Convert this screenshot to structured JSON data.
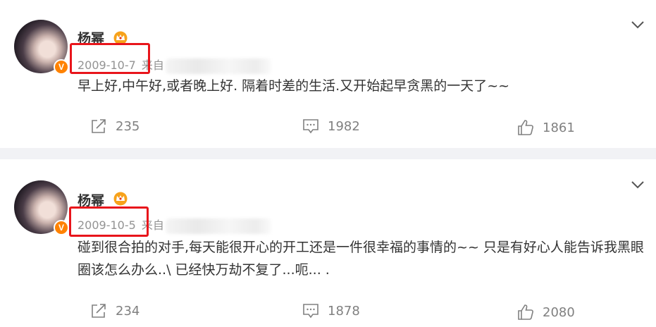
{
  "posts": [
    {
      "username": "杨幂",
      "date": "2009-10-7",
      "source_prefix": "来自",
      "text": "早上好,中午好,或者晚上好.  隔着时差的生活.又开始起早贪黑的一天了~~",
      "repost_count": "235",
      "comment_count": "1982",
      "like_count": "1861"
    },
    {
      "username": "杨幂",
      "date": "2009-10-5",
      "source_prefix": "来自",
      "text": "碰到很合拍的对手,每天能很开心的开工还是一件很幸福的事情的~~  只是有好心人能告诉我黑眼圈该怎么办么..\\  已经快万劫不复了...呃...  .",
      "repost_count": "234",
      "comment_count": "1878",
      "like_count": "2080"
    }
  ],
  "icons": {
    "verified": "verified-v-badge",
    "vip": "crown-icon",
    "repost": "repost-icon",
    "comment": "comment-icon",
    "like": "like-icon",
    "menu": "chevron-down-icon"
  },
  "colors": {
    "highlight_box": "#e8151b",
    "verified_badge": "#ff8200",
    "crown": "#f7a21b",
    "meta_text": "#939393",
    "separator": "#f1f2f5"
  }
}
